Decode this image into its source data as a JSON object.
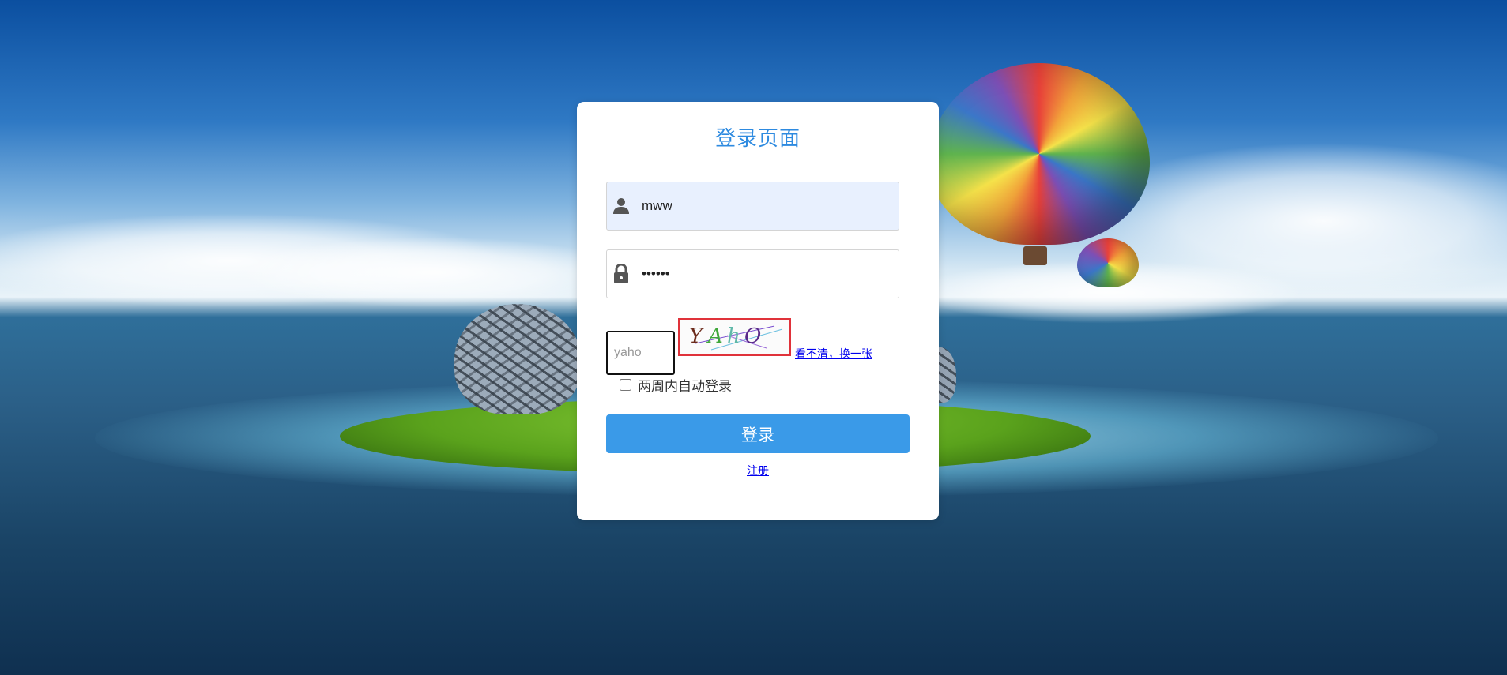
{
  "login": {
    "title": "登录页面",
    "username": {
      "value": "mww",
      "icon": "user-icon"
    },
    "password": {
      "value": "••••••",
      "icon": "lock-icon"
    },
    "captcha": {
      "input_value": "yaho",
      "image_chars": [
        "Y",
        "A",
        "h",
        "O"
      ],
      "refresh_label": "看不清，换一张"
    },
    "remember_label": "两周内自动登录",
    "remember_checked": false,
    "submit_label": "登录",
    "register_label": "注册"
  },
  "colors": {
    "accent": "#3a9ae8",
    "title": "#2d8ae0",
    "captcha_border": "#e0323a",
    "link": "#0000ee"
  }
}
